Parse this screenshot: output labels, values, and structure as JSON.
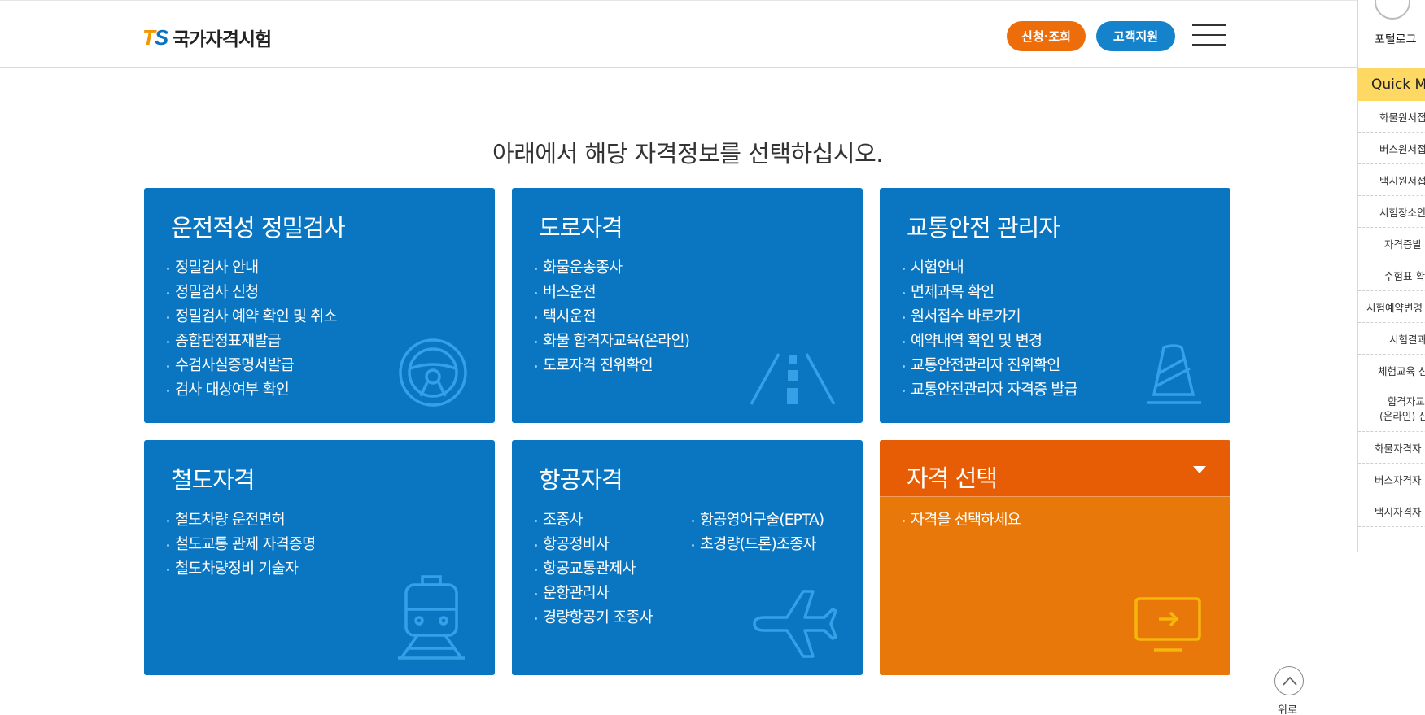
{
  "header": {
    "logo_ts_t": "T",
    "logo_ts_s": "S",
    "logo_text": "국가자격시험",
    "apply_button": "신청·조회",
    "support_button": "고객지원"
  },
  "main": {
    "title": "아래에서 해당 자격정보를 선택하십시오."
  },
  "cards": [
    {
      "title": "운전적성 정밀검사",
      "items": [
        "정밀검사 안내",
        "정밀검사 신청",
        "정밀검사 예약 확인 및 취소",
        "종합판정표재발급",
        "수검사실증명서발급",
        "검사 대상여부 확인"
      ]
    },
    {
      "title": "도로자격",
      "items": [
        "화물운송종사",
        "버스운전",
        "택시운전",
        "화물 합격자교육(온라인)",
        "도로자격 진위확인"
      ]
    },
    {
      "title": "교통안전 관리자",
      "items": [
        "시험안내",
        "면제과목 확인",
        "원서접수 바로가기",
        "예약내역 확인 및 변경",
        "교통안전관리자 진위확인",
        "교통안전관리자 자격증 발급"
      ]
    },
    {
      "title": "철도자격",
      "items": [
        "철도차량 운전면허",
        "철도교통 관제 자격증명",
        "철도차량정비 기술자"
      ]
    },
    {
      "title": "항공자격",
      "items": [
        "조종사",
        "항공정비사",
        "항공교통관제사",
        "운항관리사",
        "경량항공기 조종사"
      ],
      "items_col2": [
        "항공영어구술(EPTA)",
        "초경량(드론)조종자"
      ]
    },
    {
      "title": "자격 선택",
      "items": [
        "자격을 선택하세요"
      ]
    }
  ],
  "quick_menu": {
    "portal_label": "포털로그",
    "title": "Quick M",
    "items": [
      "화물원서접",
      "버스원서접",
      "택시원서접",
      "시험장소안",
      "자격증발",
      "수험표 확",
      "시험예약변경",
      "시험결과",
      "체험교육 신"
    ],
    "tall_item": [
      "합격자교",
      "(온라인) 신"
    ],
    "items_after": [
      "화물자격자",
      "버스자격자",
      "택시자격자"
    ]
  },
  "top_button": {
    "label": "위로"
  },
  "colors": {
    "card_blue": "#0a76c2",
    "card_orange": "#e8780a",
    "card_orange_head": "#e75d05",
    "pill_orange": "#ee6d0b",
    "pill_blue": "#1583cc",
    "quick_head": "#fdd862"
  },
  "icons": [
    "steering-wheel-icon",
    "road-icon",
    "traffic-cone-icon",
    "train-icon",
    "airplane-icon",
    "monitor-icon"
  ]
}
